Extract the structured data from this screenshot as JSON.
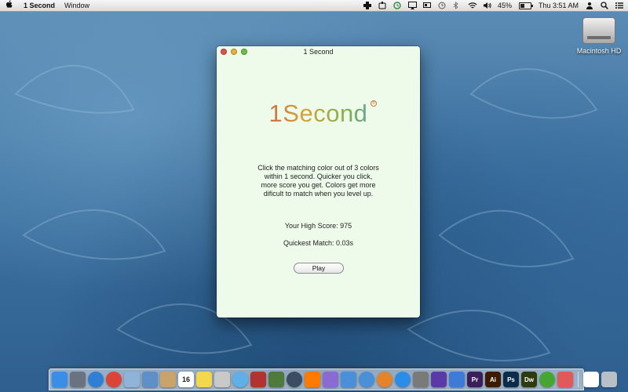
{
  "menubar": {
    "apple_icon": "apple-icon",
    "app_name": "1 Second",
    "menus": [
      "Window"
    ],
    "battery_percent": "45%",
    "battery_level": 0.45,
    "clock": "Thu 3:51 AM"
  },
  "desktop": {
    "drive_label": "Macintosh HD"
  },
  "window": {
    "title": "1 Second",
    "logo": "1Second",
    "description": "Click the matching color out of 3 colors within 1 second. Quicker you click, more score you get. Colors get more dificult to match when you level up.",
    "high_score": "Your High Score: 975",
    "quickest_match": "Quickest Match: 0.03s",
    "play_label": "Play"
  },
  "dock": {
    "icons": [
      {
        "name": "finder-icon",
        "color": "#3a8ee6"
      },
      {
        "name": "launchpad-icon",
        "color": "#6b7280"
      },
      {
        "name": "safari-icon",
        "color": "#2f7fd6"
      },
      {
        "name": "chrome-icon",
        "color": "#db4437"
      },
      {
        "name": "mail-icon",
        "color": "#8fb3d9"
      },
      {
        "name": "preview-icon",
        "color": "#5e8fc8"
      },
      {
        "name": "notes-icon",
        "color": "#c8a46a"
      },
      {
        "name": "calendar-icon",
        "color": "#ffffff",
        "text": "16"
      },
      {
        "name": "stickies-icon",
        "color": "#f2d84a"
      },
      {
        "name": "contacts-icon",
        "color": "#c9c9c9"
      },
      {
        "name": "messages-icon",
        "color": "#5fb0e8"
      },
      {
        "name": "photobooth-icon",
        "color": "#b23232"
      },
      {
        "name": "textedit-icon",
        "color": "#4e7a3a"
      },
      {
        "name": "quicktime-icon",
        "color": "#3c4c63"
      },
      {
        "name": "ibooks-icon",
        "color": "#ff7a00"
      },
      {
        "name": "photos-icon",
        "color": "#8a6bd1"
      },
      {
        "name": "keynote-icon",
        "color": "#4a8fd8"
      },
      {
        "name": "itunes-icon",
        "color": "#4a90d9"
      },
      {
        "name": "books-icon",
        "color": "#e3842a"
      },
      {
        "name": "appstore-icon",
        "color": "#2a8de8"
      },
      {
        "name": "preferences-icon",
        "color": "#7a7a7a"
      },
      {
        "name": "imovie-icon",
        "color": "#5a3aa8"
      },
      {
        "name": "xcode-icon",
        "color": "#3d7bd6"
      },
      {
        "name": "premiere-icon",
        "color": "#3a1f5c",
        "text": "Pr"
      },
      {
        "name": "illustrator-icon",
        "color": "#3d1b02",
        "text": "Ai"
      },
      {
        "name": "photoshop-icon",
        "color": "#0b2d4a",
        "text": "Ps"
      },
      {
        "name": "dreamweaver-icon",
        "color": "#2e3b0e",
        "text": "Dw"
      },
      {
        "name": "utorrent-icon",
        "color": "#45a632"
      },
      {
        "name": "app-grid-icon",
        "color": "#e05a5a"
      },
      {
        "name": "document-icon",
        "color": "#ffffff"
      },
      {
        "name": "trash-icon",
        "color": "#b9bfc7"
      }
    ]
  }
}
